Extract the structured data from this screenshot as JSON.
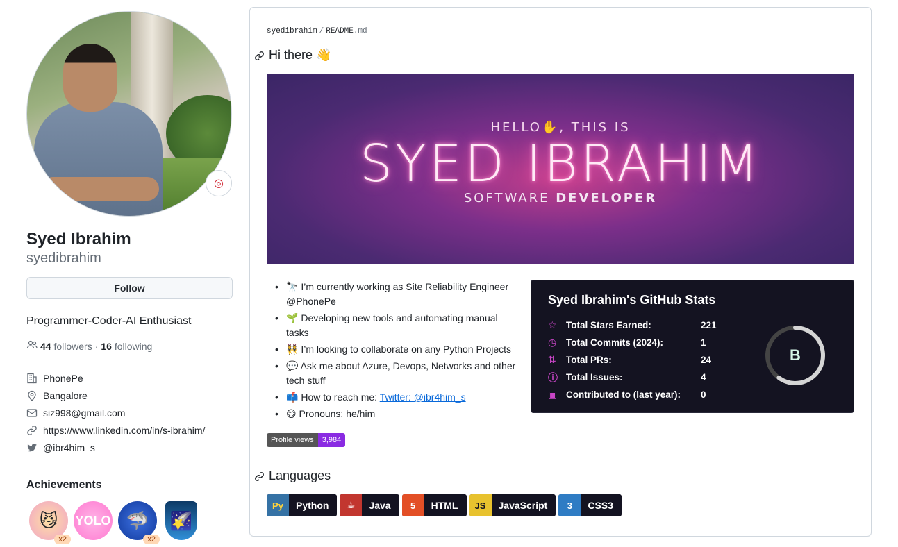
{
  "profile": {
    "name": "Syed Ibrahim",
    "username": "syedibrahim",
    "follow_label": "Follow",
    "bio": "Programmer-Coder-AI Enthusiast",
    "followers_count": "44",
    "followers_label": "followers",
    "separator": "·",
    "following_count": "16",
    "following_label": "following",
    "company": "PhonePe",
    "location": "Bangalore",
    "email": "siz998@gmail.com",
    "website": "https://www.linkedin.com/in/s-ibrahim/",
    "twitter": "@ibr4him_s",
    "status_icon": "target-icon"
  },
  "achievements": {
    "title": "Achievements",
    "badges": [
      {
        "name": "pull-shark",
        "count": "x2"
      },
      {
        "name": "yolo",
        "count": ""
      },
      {
        "name": "quickdraw",
        "count": "x2"
      },
      {
        "name": "starstruck",
        "count": ""
      }
    ]
  },
  "readme": {
    "path_user": "syedibrahim",
    "path_sep": "/",
    "path_file": "README",
    "path_ext": ".md",
    "heading_hi": "Hi there 👋",
    "banner": {
      "hello": "HELLO✋, THIS IS",
      "name": "SYED IBRAHIM",
      "role_light": "SOFTWARE",
      "role_bold": "DEVELOPER"
    },
    "bullets": [
      {
        "emoji": "🔭",
        "text": "I’m currently working as Site Reliability Engineer @PhonePe"
      },
      {
        "emoji": "🌱",
        "text": "Developing new tools and automating manual tasks"
      },
      {
        "emoji": "👯",
        "text": "I’m looking to collaborate on any Python Projects"
      },
      {
        "emoji": "💬",
        "text": "Ask me about Azure, Devops, Networks and other tech stuff"
      },
      {
        "emoji": "📫",
        "text": "How to reach me:",
        "link": "Twitter: @ibr4him_s"
      },
      {
        "emoji": "😄",
        "text": "Pronouns: he/him"
      }
    ],
    "profile_views_label": "Profile views",
    "profile_views_value": "3,984",
    "heading_languages": "Languages",
    "languages": [
      "Python",
      "Java",
      "HTML",
      "JavaScript",
      "CSS3"
    ]
  },
  "stats": {
    "title": "Syed Ibrahim's GitHub Stats",
    "rows": [
      {
        "icon": "star-icon",
        "label": "Total Stars Earned:",
        "value": "221"
      },
      {
        "icon": "clock-icon",
        "label": "Total Commits (2024):",
        "value": "1"
      },
      {
        "icon": "pr-icon",
        "label": "Total PRs:",
        "value": "24"
      },
      {
        "icon": "issue-icon",
        "label": "Total Issues:",
        "value": "4"
      },
      {
        "icon": "repo-icon",
        "label": "Contributed to (last year):",
        "value": "0"
      }
    ],
    "grade": "B",
    "grade_progress": 0.6,
    "colors": {
      "bg": "#141321",
      "title": "#ffffff",
      "icon": "#c845c6",
      "ring": "#d5d5d5",
      "ring_track": "#444444"
    }
  }
}
